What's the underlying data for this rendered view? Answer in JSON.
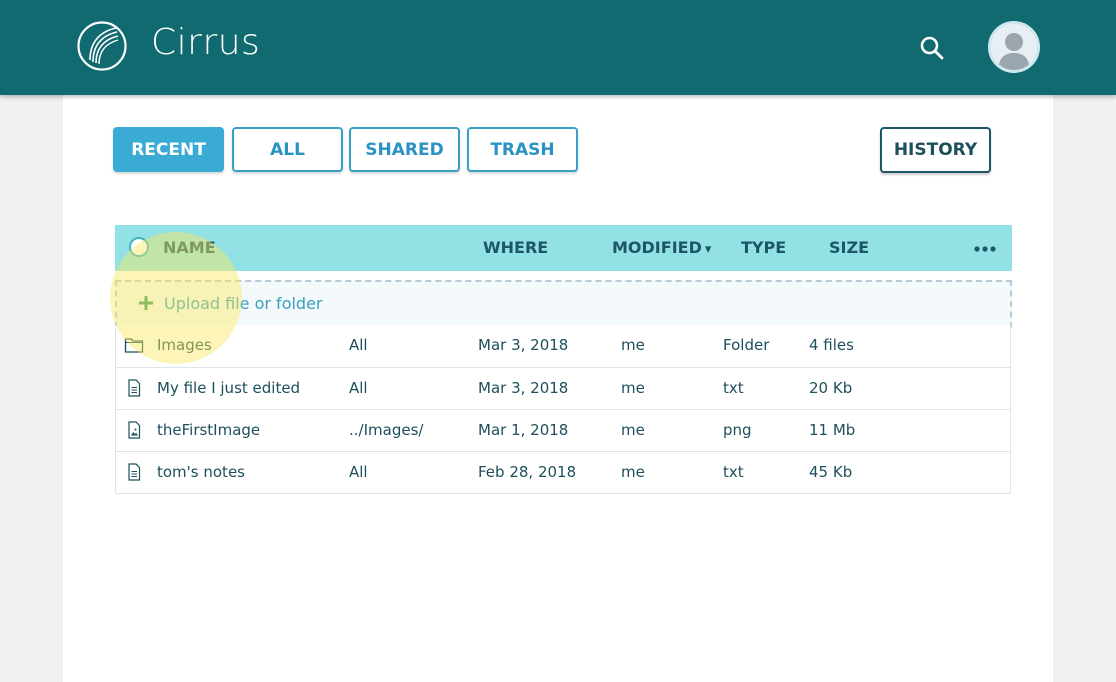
{
  "app": {
    "name": "Cirrus"
  },
  "header": {
    "search_icon": "search-icon",
    "avatar_icon": "user-avatar"
  },
  "tabs": [
    {
      "label": "RECENT",
      "active": true
    },
    {
      "label": "ALL",
      "active": false
    },
    {
      "label": "SHARED",
      "active": false
    },
    {
      "label": "TRASH",
      "active": false
    }
  ],
  "history_button": {
    "label": "HISTORY"
  },
  "table": {
    "columns": {
      "name": "NAME",
      "where": "WHERE",
      "modified": "MODIFIED",
      "type": "TYPE",
      "size": "SIZE"
    },
    "sort_indicator": "▾",
    "more_icon": "more-horizontal-icon",
    "upload": {
      "label": "Upload file or folder",
      "icon": "plus-icon"
    },
    "rows": [
      {
        "icon": "folder-icon",
        "name": "Images",
        "where": "All",
        "modified": "Mar 3, 2018",
        "owner": "me",
        "type": "Folder",
        "size": "4 files"
      },
      {
        "icon": "text-file-icon",
        "name": "My file I just edited",
        "where": "All",
        "modified": "Mar 3, 2018",
        "owner": "me",
        "type": "txt",
        "size": "20 Kb"
      },
      {
        "icon": "image-file-icon",
        "name": "theFirstImage",
        "where": "../Images/",
        "modified": "Mar 1, 2018",
        "owner": "me",
        "type": "png",
        "size": "11 Mb"
      },
      {
        "icon": "text-file-icon",
        "name": "tom's notes",
        "where": "All",
        "modified": "Feb 28, 2018",
        "owner": "me",
        "type": "txt",
        "size": "45 Kb"
      }
    ]
  },
  "colors": {
    "header": "#106a70",
    "accent": "#3aabd5",
    "table_header": "#92e1e4",
    "highlight": "#fae85f"
  }
}
